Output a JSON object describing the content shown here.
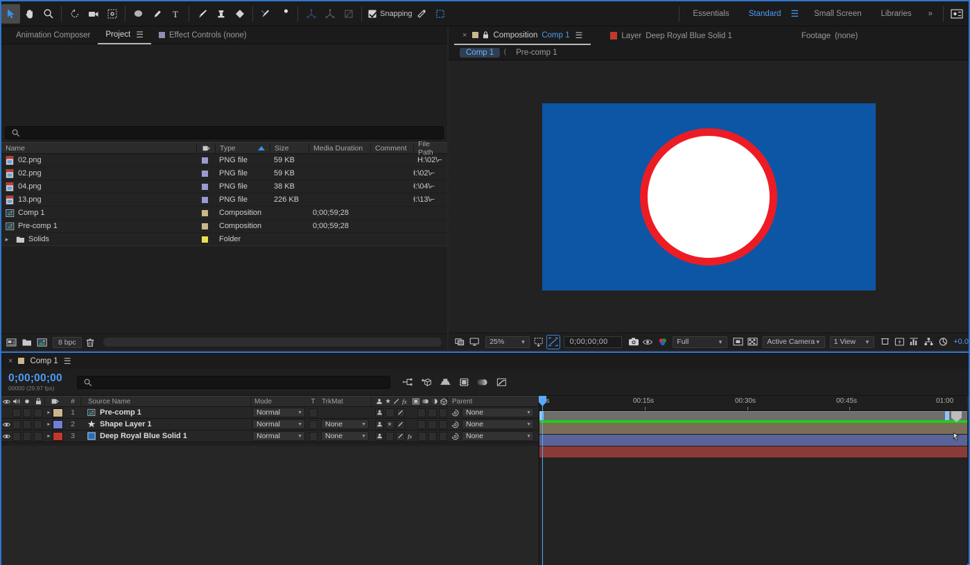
{
  "toolbar": {
    "tools": [
      {
        "name": "selection-tool",
        "glyph": "arrow",
        "selected": true
      },
      {
        "name": "hand-tool",
        "glyph": "hand",
        "selected": false
      },
      {
        "name": "zoom-tool",
        "glyph": "magnifier",
        "selected": false
      },
      {
        "name": "rotation-tool",
        "glyph": "rotate",
        "selected": false
      },
      {
        "name": "camera-tool",
        "glyph": "camera",
        "selected": false
      },
      {
        "name": "pan-behind-tool",
        "glyph": "anchor-box",
        "selected": false
      },
      {
        "name": "shape-tool",
        "glyph": "ellipse",
        "selected": false
      },
      {
        "name": "pen-tool",
        "glyph": "pen",
        "selected": false
      },
      {
        "name": "type-tool",
        "glyph": "type",
        "selected": false
      },
      {
        "name": "brush-tool",
        "glyph": "brush",
        "selected": false
      },
      {
        "name": "clone-stamp-tool",
        "glyph": "stamp",
        "selected": false
      },
      {
        "name": "eraser-tool",
        "glyph": "eraser",
        "selected": false
      },
      {
        "name": "roto-brush-tool",
        "glyph": "roto-brush",
        "selected": false
      },
      {
        "name": "puppet-pin-tool",
        "glyph": "puppet-pin",
        "selected": false
      }
    ],
    "snapping_label": "Snapping",
    "snapping_checked": true,
    "workspaces": [
      {
        "label": "Essentials",
        "active": false
      },
      {
        "label": "Standard",
        "active": true
      },
      {
        "label": "Small Screen",
        "active": false
      },
      {
        "label": "Libraries",
        "active": false
      }
    ],
    "overflow_label": "»",
    "accent": "#4d9bf5"
  },
  "project_panel": {
    "tabs": [
      {
        "label": "Animation Composer",
        "selected": false,
        "swatch": null
      },
      {
        "label": "Project",
        "selected": true,
        "swatch": null,
        "menu": "☰"
      },
      {
        "label": "Effect Controls (none)",
        "selected": false,
        "swatch": "#8e8eb4"
      }
    ],
    "search_placeholder": "",
    "columns": [
      "Name",
      "",
      "Type",
      "Size",
      "Media Duration",
      "Comment",
      "File Path"
    ],
    "sort_column": "Type",
    "items": [
      {
        "name": "02.png",
        "icon": "png-file-icon",
        "label_color": "#9a9ad2",
        "type": "PNG file",
        "size": "59 KB",
        "duration": "",
        "comment": "",
        "path": "H:\\02\\⌐",
        "extra_icon": "proxy-icon"
      },
      {
        "name": "02.png",
        "icon": "png-file-icon",
        "label_color": "#9a9ad2",
        "type": "PNG file",
        "size": "59 KB",
        "duration": "",
        "comment": "",
        "path": "H:\\02\\⌐",
        "extra_icon": null
      },
      {
        "name": "04.png",
        "icon": "png-file-icon",
        "label_color": "#9a9ad2",
        "type": "PNG file",
        "size": "38 KB",
        "duration": "",
        "comment": "",
        "path": "H:\\04\\⌐",
        "extra_icon": null
      },
      {
        "name": "13.png",
        "icon": "png-file-icon",
        "label_color": "#9a9ad2",
        "type": "PNG file",
        "size": "226 KB",
        "duration": "",
        "comment": "",
        "path": "H:\\13\\⌐",
        "extra_icon": null
      },
      {
        "name": "Comp 1",
        "icon": "composition-icon",
        "label_color": "#cbb68c",
        "type": "Composition",
        "size": "",
        "duration": "0;00;59;28",
        "comment": "",
        "path": "",
        "extra_icon": null
      },
      {
        "name": "Pre-comp 1",
        "icon": "composition-icon",
        "label_color": "#cbb68c",
        "type": "Composition",
        "size": "",
        "duration": "0;00;59;28",
        "comment": "",
        "path": "",
        "extra_icon": null
      },
      {
        "name": "Solids",
        "icon": "folder-icon",
        "label_color": "#e8e34a",
        "type": "Folder",
        "size": "",
        "duration": "",
        "comment": "",
        "path": "",
        "extra_icon": null
      }
    ],
    "footer": {
      "bit_depth": "8 bpc",
      "buttons": [
        "interpret-footage-icon",
        "new-folder-icon",
        "new-composition-icon",
        "delete-icon"
      ]
    }
  },
  "comp_panel": {
    "tabs": [
      {
        "label_prefix": "Composition",
        "label_value": "Comp 1",
        "selected": true,
        "swatch": "#cbb68c",
        "lock": true,
        "closable": true,
        "menu": "☰"
      },
      {
        "label_prefix": "Layer",
        "label_value": "Deep Royal Blue Solid 1",
        "selected": false,
        "swatch": "#c0392b",
        "lock": false,
        "closable": false,
        "menu": null
      },
      {
        "label_prefix": "Footage",
        "label_value": "(none)",
        "selected": false,
        "swatch": null,
        "lock": false,
        "closable": false,
        "menu": null
      }
    ],
    "breadcrumb": [
      {
        "label": "Comp 1",
        "selected": true
      },
      {
        "label": "Pre-comp 1",
        "selected": false
      }
    ],
    "artwork": {
      "background_color": "#0d56a6",
      "circle_fill": "#ffffff",
      "circle_stroke": "#ed1c24"
    },
    "footer": {
      "magnification": "25%",
      "timecode": "0;00;00;00",
      "resolution": "Full",
      "camera_view": "Active Camera",
      "view_layout": "1 View",
      "exposure": "+0.0",
      "icons_left": [
        "always-preview-icon",
        "main-viewer-icon"
      ],
      "icons_mid": [
        "region-of-interest-icon",
        "transparency-grid-icon",
        "snapshot-icon",
        "show-snapshot-icon",
        "channels-icon"
      ],
      "icons_right": [
        "toggle-mask-icon",
        "transparency-icon",
        "timeline-icon",
        "comp-flowchart-icon",
        "reset-exposure-icon"
      ]
    }
  },
  "timeline": {
    "tab": {
      "label": "Comp 1",
      "swatch": "#cbb68c",
      "menu": "☰"
    },
    "current_time": "0;00;00;00",
    "frame_info": "00000 (29.97 fps)",
    "search_placeholder": "",
    "toolbar_icons": [
      "composition-mini-flowchart-icon",
      "draft-3d-icon",
      "hide-shy-layers-icon",
      "frame-blending-icon",
      "motion-blur-icon",
      "graph-editor-icon"
    ],
    "columns": {
      "av": [
        "video-icon",
        "audio-icon",
        "solo-icon",
        "lock-icon"
      ],
      "label": "label-icon",
      "number": "#",
      "source_name": "Source Name",
      "mode": "Mode",
      "t": "T",
      "trkmat": "TrkMat",
      "switches": [
        "shy-icon",
        "collapse-icon",
        "quality-icon",
        "effects-icon",
        "frame-blend-icon",
        "motion-blur-icon",
        "adjustment-icon",
        "3d-layer-icon"
      ],
      "parent": "Parent"
    },
    "layers": [
      {
        "num": "1",
        "name": "Pre-comp 1",
        "icon": "composition-icon",
        "color": "#cbb68c",
        "visible": false,
        "mode": "Normal",
        "trkmat": null,
        "parent": "None",
        "bar_color": "#7b6e58",
        "has_fx": false,
        "has_star": false
      },
      {
        "num": "2",
        "name": "Shape Layer 1",
        "icon": "star-icon",
        "color": "#6f7fd6",
        "visible": true,
        "mode": "Normal",
        "trkmat": "None",
        "parent": "None",
        "bar_color": "#5a6499",
        "has_fx": false,
        "has_star": true
      },
      {
        "num": "3",
        "name": "Deep Royal Blue Solid 1",
        "icon": "solid-icon",
        "color": "#c0392b",
        "visible": true,
        "mode": "Normal",
        "trkmat": "None",
        "parent": "None",
        "bar_color": "#8a3b39",
        "has_fx": true,
        "has_star": false
      }
    ],
    "ruler_ticks": [
      {
        "label": "0s",
        "pos_pct": 0.8
      },
      {
        "label": "00:15s",
        "pos_pct": 24.2
      },
      {
        "label": "00:30s",
        "pos_pct": 48.0
      },
      {
        "label": "00:45s",
        "pos_pct": 71.5
      },
      {
        "label": "01:00",
        "pos_pct": 95.3
      }
    ],
    "work_area_start_pct": 0,
    "work_area_end_pct": 100,
    "cti_pct": 0.6
  }
}
